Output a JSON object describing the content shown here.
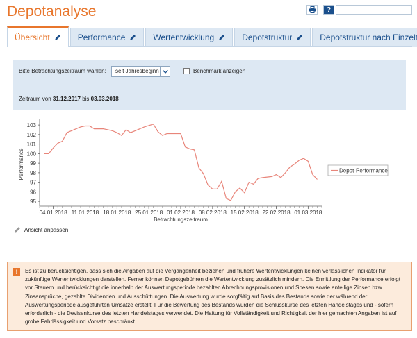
{
  "header": {
    "title": "Depotanalyse",
    "print_icon": "printer-icon",
    "help_label": "?"
  },
  "tabs": [
    {
      "label": "Übersicht",
      "active": true
    },
    {
      "label": "Performance",
      "active": false
    },
    {
      "label": "Wertentwicklung",
      "active": false
    },
    {
      "label": "Depotstruktur",
      "active": false
    },
    {
      "label": "Depotstruktur nach Einzeltitel",
      "active": false
    }
  ],
  "filter": {
    "period_label": "Bitte Betrachtungszeitraum wählen:",
    "period_value": "seit Jahresbeginn",
    "benchmark_label": "Benchmark anzeigen",
    "benchmark_checked": false,
    "range_prefix": "Zeitraum von",
    "range_from": "31.12.2017",
    "range_mid": "bis",
    "range_to": "03.03.2018"
  },
  "chart_data": {
    "type": "line",
    "xlabel": "Betrachtungszeitraum",
    "ylabel": "Performance",
    "ylim": [
      94.5,
      103.3
    ],
    "yticks": [
      95,
      96,
      97,
      98,
      99,
      100,
      101,
      102,
      103
    ],
    "xlim": [
      "2018-01-01",
      "2018-03-04"
    ],
    "xtick_labels": [
      "04.01.2018",
      "11.01.2018",
      "18.01.2018",
      "25.01.2018",
      "01.02.2018",
      "08.02.2018",
      "15.02.2018",
      "22.02.2018",
      "01.03.2018"
    ],
    "xtick_dates": [
      "2018-01-04",
      "2018-01-11",
      "2018-01-18",
      "2018-01-25",
      "2018-02-01",
      "2018-02-08",
      "2018-02-15",
      "2018-02-22",
      "2018-03-01"
    ],
    "grid": false,
    "legend_position": "right",
    "color": "#e8857a",
    "series": [
      {
        "name": "Depot-Performance",
        "points": [
          [
            "2018-01-02",
            100.0
          ],
          [
            "2018-01-03",
            100.0
          ],
          [
            "2018-01-04",
            100.6
          ],
          [
            "2018-01-05",
            101.1
          ],
          [
            "2018-01-06",
            101.3
          ],
          [
            "2018-01-07",
            102.2
          ],
          [
            "2018-01-08",
            102.4
          ],
          [
            "2018-01-10",
            102.8
          ],
          [
            "2018-01-11",
            102.9
          ],
          [
            "2018-01-12",
            102.9
          ],
          [
            "2018-01-13",
            102.6
          ],
          [
            "2018-01-15",
            102.6
          ],
          [
            "2018-01-16",
            102.5
          ],
          [
            "2018-01-17",
            102.4
          ],
          [
            "2018-01-18",
            102.2
          ],
          [
            "2018-01-19",
            101.9
          ],
          [
            "2018-01-20",
            102.5
          ],
          [
            "2018-01-21",
            102.2
          ],
          [
            "2018-01-22",
            102.4
          ],
          [
            "2018-01-24",
            102.8
          ],
          [
            "2018-01-26",
            103.1
          ],
          [
            "2018-01-27",
            102.3
          ],
          [
            "2018-01-28",
            101.9
          ],
          [
            "2018-01-29",
            102.1
          ],
          [
            "2018-01-30",
            102.1
          ],
          [
            "2018-02-01",
            102.1
          ],
          [
            "2018-02-02",
            100.7
          ],
          [
            "2018-02-03",
            100.5
          ],
          [
            "2018-02-04",
            100.4
          ],
          [
            "2018-02-05",
            98.5
          ],
          [
            "2018-02-06",
            97.9
          ],
          [
            "2018-02-07",
            96.7
          ],
          [
            "2018-02-08",
            96.3
          ],
          [
            "2018-02-09",
            96.3
          ],
          [
            "2018-02-10",
            97.1
          ],
          [
            "2018-02-11",
            95.3
          ],
          [
            "2018-02-12",
            95.1
          ],
          [
            "2018-02-13",
            96.0
          ],
          [
            "2018-02-14",
            96.4
          ],
          [
            "2018-02-15",
            95.9
          ],
          [
            "2018-02-16",
            97.0
          ],
          [
            "2018-02-17",
            96.8
          ],
          [
            "2018-02-18",
            97.4
          ],
          [
            "2018-02-19",
            97.5
          ],
          [
            "2018-02-21",
            97.6
          ],
          [
            "2018-02-22",
            97.8
          ],
          [
            "2018-02-23",
            97.5
          ],
          [
            "2018-02-24",
            98.0
          ],
          [
            "2018-02-25",
            98.6
          ],
          [
            "2018-02-26",
            98.9
          ],
          [
            "2018-02-27",
            99.3
          ],
          [
            "2018-02-28",
            99.5
          ],
          [
            "2018-03-01",
            99.2
          ],
          [
            "2018-03-02",
            97.8
          ],
          [
            "2018-03-03",
            97.3
          ]
        ]
      }
    ]
  },
  "adjust": {
    "label": "Ansicht anpassen"
  },
  "disclaimer": {
    "icon": "warning-icon",
    "icon_glyph": "!",
    "text": "Es ist zu berücksichtigen, dass sich die Angaben auf die Vergangenheit beziehen und frühere Wertentwicklungen keinen verlässlichen Indikator für zukünftige Wertentwicklungen darstellen. Ferner können Depotgebühren die Wertentwicklung zusätzlich mindern. Die Ermittlung der Performance erfolgt vor Steuern und berücksichtigt die innerhalb der Auswertungsperiode bezahlten Abrechnungsprovisionen und Spesen sowie anteilige Zinsen bzw. Zinsansprüche, gezahlte Dividenden und Ausschüttungen. Die Auswertung wurde sorgfältig auf Basis des Bestands sowie der während der Auswertungsperiode ausgeführten Umsätze erstellt. Für die Bewertung des Bestands wurden die Schlusskurse des letzten Handelstages und - sofern erforderlich - die Devisenkurse des letzten Handelstages verwendet. Die Haftung für Vollständigkeit und Richtigkeit der hier gemachten Angaben ist auf grobe Fahrlässigkeit und Vorsatz beschränkt."
  },
  "colors": {
    "accent": "#e8762c",
    "link": "#1a4f8c",
    "panel": "#dde8f3",
    "disclaimer_bg": "#fcebdc"
  }
}
